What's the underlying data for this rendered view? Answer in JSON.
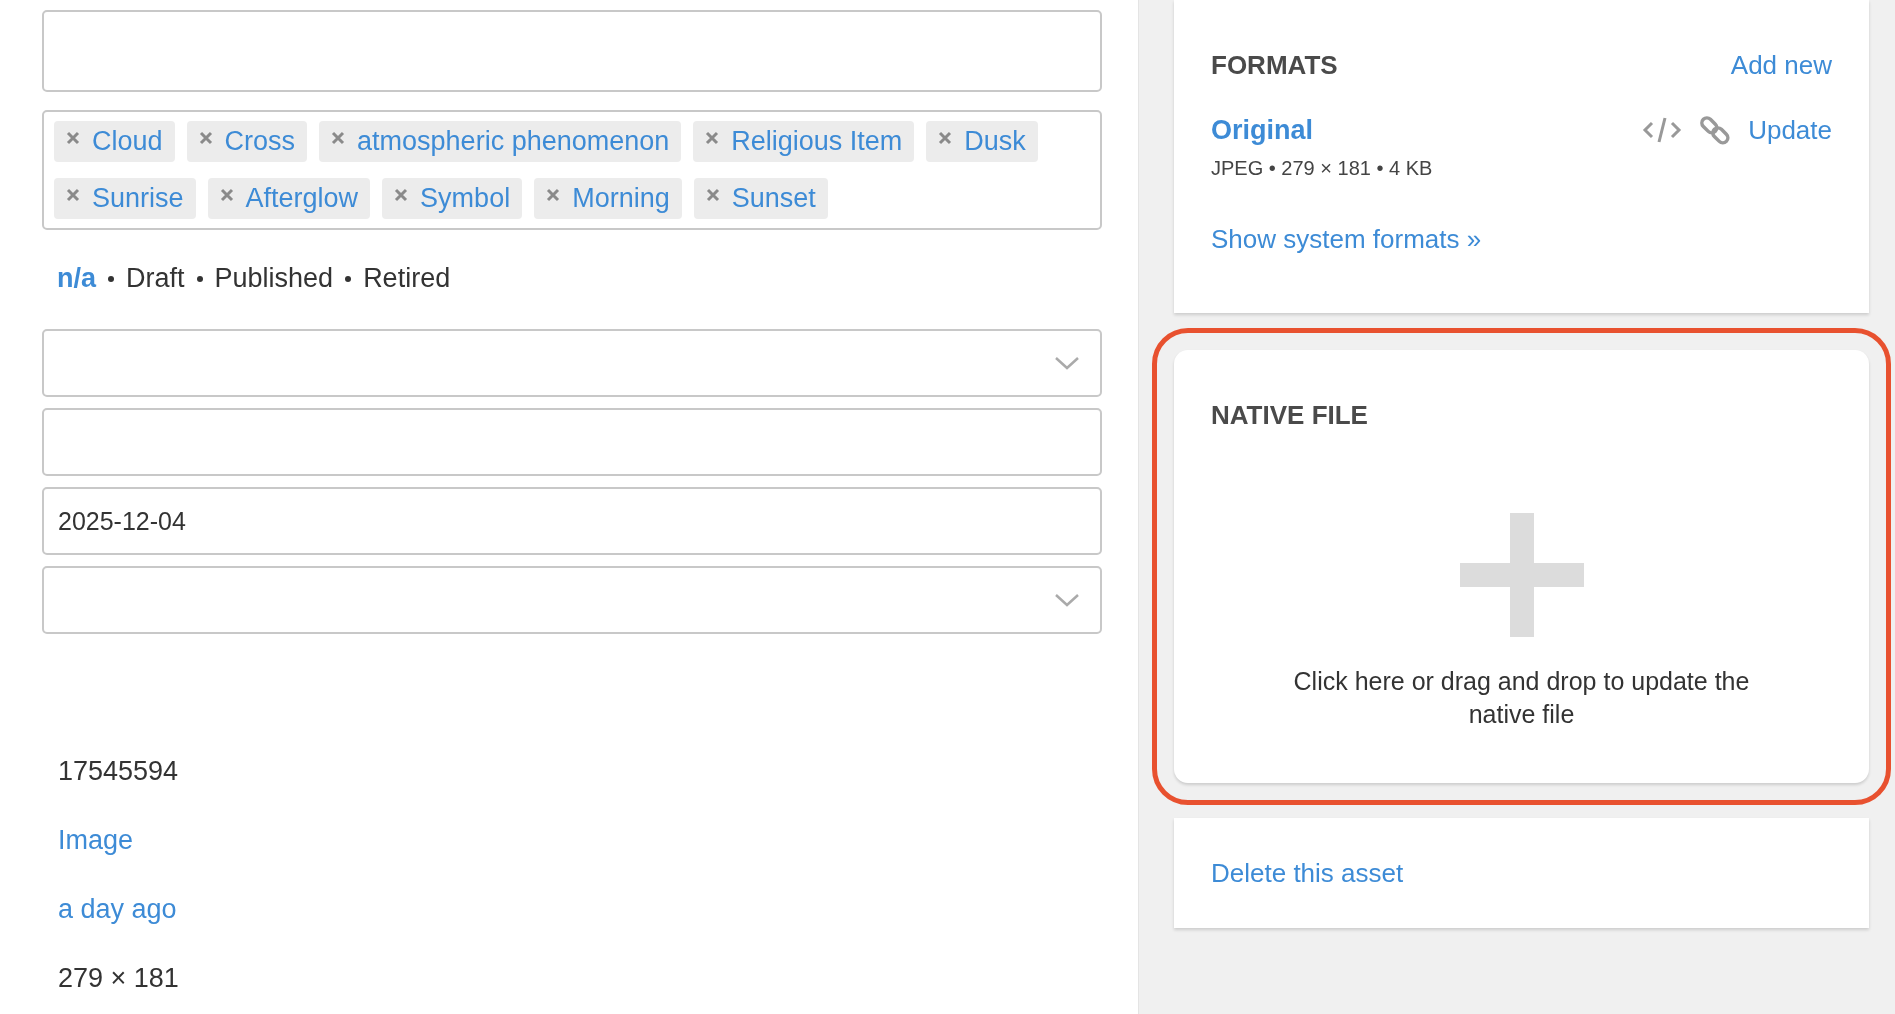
{
  "fields": [
    {
      "kind": "input"
    },
    {
      "kind": "tags",
      "tags": [
        "Cloud",
        "Cross",
        "atmospheric phenomenon",
        "Religious Item",
        "Dusk",
        "Sunrise",
        "Afterglow",
        "Symbol",
        "Morning",
        "Sunset"
      ]
    },
    {
      "kind": "status",
      "options": [
        {
          "label": "n/a",
          "selected": true
        },
        {
          "label": "Draft",
          "selected": false
        },
        {
          "label": "Published",
          "selected": false
        },
        {
          "label": "Retired",
          "selected": false
        }
      ]
    },
    {
      "kind": "select"
    },
    {
      "kind": "input"
    },
    {
      "kind": "input",
      "value": "2025-12-04"
    },
    {
      "kind": "select"
    }
  ],
  "details": [
    {
      "kind": "text",
      "text": "17545594"
    },
    {
      "kind": "link",
      "text": "Image"
    },
    {
      "kind": "link",
      "text": "a day ago"
    },
    {
      "kind": "text",
      "text": "279 × 181"
    }
  ],
  "formats": {
    "title": "FORMATS",
    "add_link": "Add new",
    "format_name": "Original",
    "update_link": "Update",
    "meta": "JPEG • 279 × 181 • 4 KB",
    "show_link": "Show system formats »"
  },
  "native_file": {
    "title": "NATIVE FILE",
    "highlighted": true,
    "hint": "Click here or drag and drop to update the native file"
  },
  "delete_link": "Delete this asset"
}
